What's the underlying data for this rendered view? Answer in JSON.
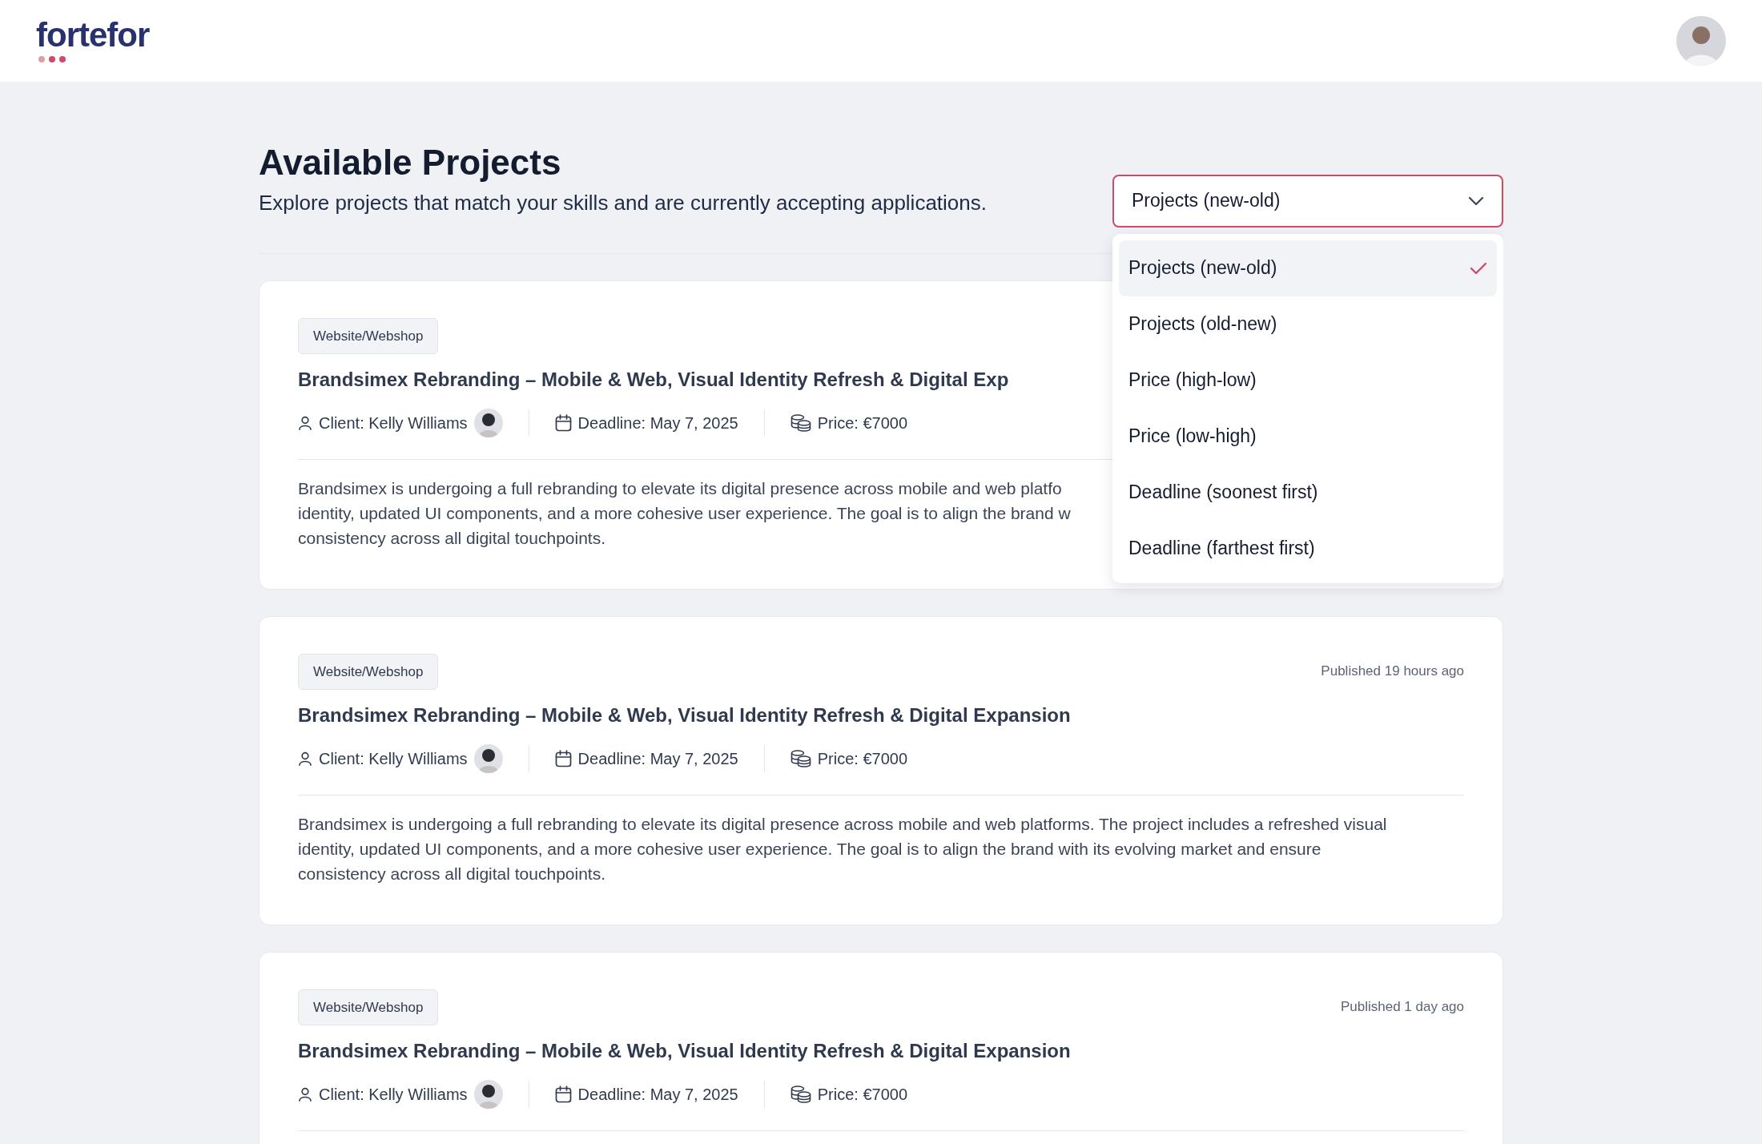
{
  "header": {
    "logo": "fortefor"
  },
  "page": {
    "title": "Available Projects",
    "subtitle": "Explore projects that match your skills and are currently accepting applications."
  },
  "sort": {
    "value": "Projects (new-old)",
    "expanded": true,
    "options": [
      {
        "label": "Projects (new-old)",
        "selected": true
      },
      {
        "label": "Projects (old-new)",
        "selected": false
      },
      {
        "label": "Price (high-low)",
        "selected": false
      },
      {
        "label": "Price (low-high)",
        "selected": false
      },
      {
        "label": "Deadline (soonest first)",
        "selected": false
      },
      {
        "label": "Deadline (farthest first)",
        "selected": false
      }
    ]
  },
  "projects": [
    {
      "tag": "Website/Webshop",
      "title": "Brandsimex Rebranding – Mobile & Web, Visual Identity Refresh & Digital Exp",
      "client": "Client: Kelly Williams",
      "deadline": "Deadline: May 7, 2025",
      "price": "Price: €7000",
      "description": [
        "Brandsimex is undergoing a full rebranding to elevate its digital presence across mobile and web platfo",
        "identity, updated UI components, and a more cohesive user experience. The goal is to align the brand w",
        "consistency across all digital touchpoints."
      ]
    },
    {
      "tag": "Website/Webshop",
      "published": "Published 19 hours ago",
      "title": "Brandsimex Rebranding – Mobile & Web, Visual Identity Refresh & Digital Expansion",
      "client": "Client: Kelly Williams",
      "deadline": "Deadline: May 7, 2025",
      "price": "Price: €7000",
      "description": [
        "Brandsimex is undergoing a full rebranding to elevate its digital presence across mobile and web platforms. The project includes a refreshed visual",
        "identity, updated UI components, and a more cohesive user experience. The goal is to align the brand with its evolving market and ensure",
        "consistency across all digital touchpoints."
      ]
    },
    {
      "tag": "Website/Webshop",
      "published": "Published 1 day ago",
      "title": "Brandsimex Rebranding – Mobile & Web, Visual Identity Refresh & Digital Expansion",
      "client": "Client: Kelly Williams",
      "deadline": "Deadline: May 7, 2025",
      "price": "Price: €7000"
    }
  ]
}
